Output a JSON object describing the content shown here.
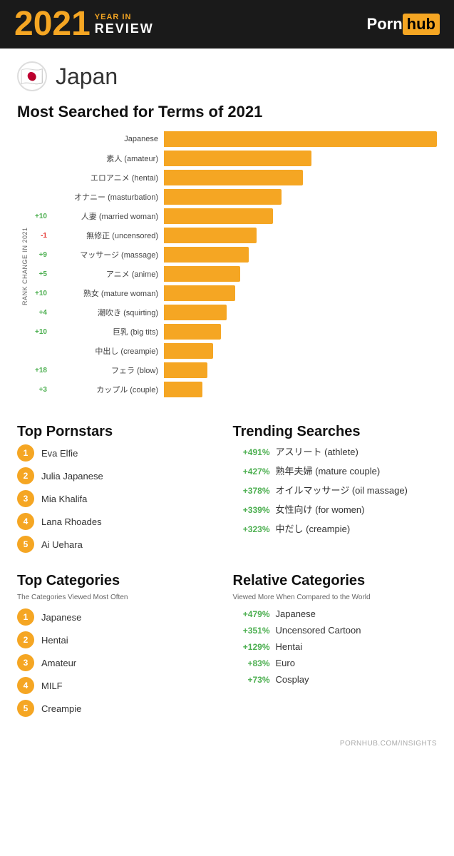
{
  "header": {
    "year": "2021",
    "year_in": "YEAR IN",
    "review": "REVIEW",
    "logo_porn": "Porn",
    "logo_hub": "hub"
  },
  "country": {
    "name": "Japan",
    "flag": "🇯🇵"
  },
  "most_searched": {
    "title": "Most Searched for Terms of 2021",
    "y_axis": "RANK CHANGE IN 2021",
    "bars": [
      {
        "label": "Japanese",
        "pct": 100,
        "change": "",
        "change_type": "empty"
      },
      {
        "label": "素人 (amateur)",
        "pct": 54,
        "change": "",
        "change_type": "empty"
      },
      {
        "label": "エロアニメ (hentai)",
        "pct": 51,
        "change": "",
        "change_type": "empty"
      },
      {
        "label": "オナニー (masturbation)",
        "pct": 43,
        "change": "",
        "change_type": "empty"
      },
      {
        "label": "人妻 (married woman)",
        "pct": 40,
        "change": "+10",
        "change_type": "positive"
      },
      {
        "label": "無修正 (uncensored)",
        "pct": 34,
        "change": "-1",
        "change_type": "negative"
      },
      {
        "label": "マッサージ (massage)",
        "pct": 31,
        "change": "+9",
        "change_type": "positive"
      },
      {
        "label": "アニメ (anime)",
        "pct": 28,
        "change": "+5",
        "change_type": "positive"
      },
      {
        "label": "熟女 (mature woman)",
        "pct": 26,
        "change": "+10",
        "change_type": "positive"
      },
      {
        "label": "潮吹き (squirting)",
        "pct": 23,
        "change": "+4",
        "change_type": "positive"
      },
      {
        "label": "巨乳 (big tits)",
        "pct": 21,
        "change": "+10",
        "change_type": "positive"
      },
      {
        "label": "中出し (creampie)",
        "pct": 18,
        "change": "",
        "change_type": "empty"
      },
      {
        "label": "フェラ (blow)",
        "pct": 16,
        "change": "+18",
        "change_type": "positive"
      },
      {
        "label": "カップル (couple)",
        "pct": 14,
        "change": "+3",
        "change_type": "positive"
      }
    ]
  },
  "top_pornstars": {
    "title": "Top Pornstars",
    "items": [
      {
        "rank": "1",
        "name": "Eva Elfie"
      },
      {
        "rank": "2",
        "name": "Julia Japanese"
      },
      {
        "rank": "3",
        "name": "Mia Khalifa"
      },
      {
        "rank": "4",
        "name": "Lana Rhoades"
      },
      {
        "rank": "5",
        "name": "Ai Uehara"
      }
    ]
  },
  "trending_searches": {
    "title": "Trending Searches",
    "items": [
      {
        "pct": "+491%",
        "term": "アスリート (athlete)"
      },
      {
        "pct": "+427%",
        "term": "熟年夫婦 (mature couple)"
      },
      {
        "pct": "+378%",
        "term": "オイルマッサージ (oil massage)"
      },
      {
        "pct": "+339%",
        "term": "女性向け (for women)"
      },
      {
        "pct": "+323%",
        "term": "中だし (creampie)"
      }
    ]
  },
  "top_categories": {
    "title": "Top Categories",
    "subtitle": "The Categories Viewed Most Often",
    "items": [
      {
        "rank": "1",
        "name": "Japanese"
      },
      {
        "rank": "2",
        "name": "Hentai"
      },
      {
        "rank": "3",
        "name": "Amateur"
      },
      {
        "rank": "4",
        "name": "MILF"
      },
      {
        "rank": "5",
        "name": "Creampie"
      }
    ]
  },
  "relative_categories": {
    "title": "Relative Categories",
    "subtitle": "Viewed More When Compared to the World",
    "items": [
      {
        "pct": "+479%",
        "term": "Japanese"
      },
      {
        "pct": "+351%",
        "term": "Uncensored Cartoon"
      },
      {
        "pct": "+129%",
        "term": "Hentai"
      },
      {
        "pct": "+83%",
        "term": "Euro"
      },
      {
        "pct": "+73%",
        "term": "Cosplay"
      }
    ]
  },
  "footer": {
    "url": "PORNHUB.COM/INSIGHTS"
  }
}
